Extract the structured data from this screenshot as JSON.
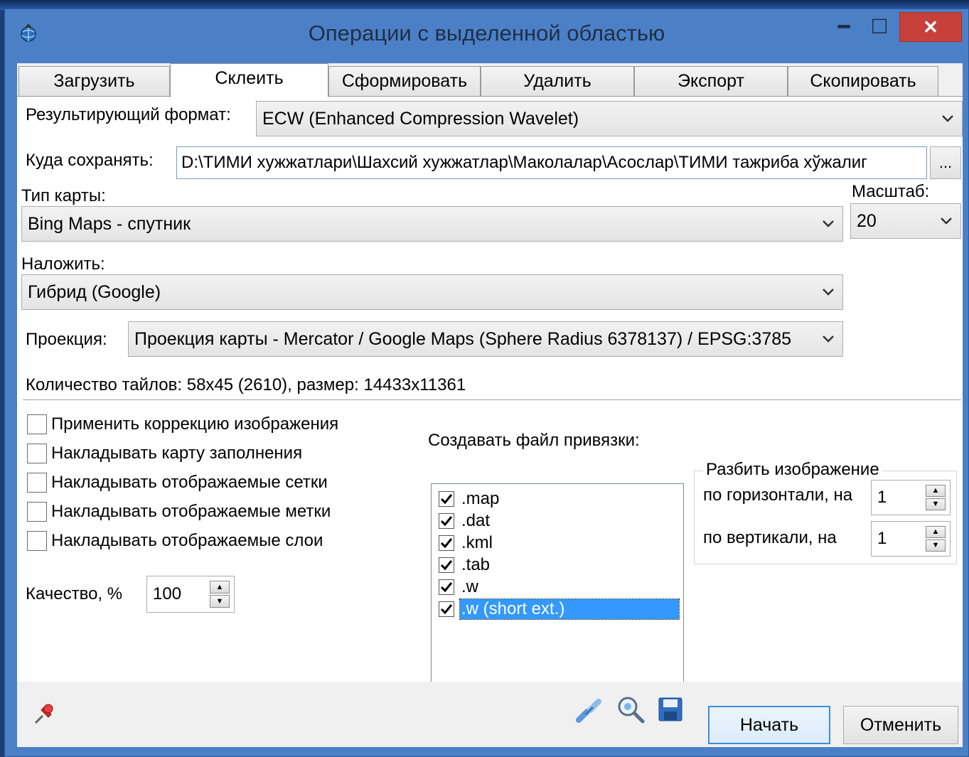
{
  "window": {
    "title": "Операции с выделенной областью",
    "controls": {
      "minimize": "━",
      "maximize": "☐",
      "close": "✕"
    }
  },
  "tabs": [
    {
      "label": "Загрузить",
      "active": false
    },
    {
      "label": "Склеить",
      "active": true
    },
    {
      "label": "Сформировать",
      "active": false
    },
    {
      "label": "Удалить",
      "active": false
    },
    {
      "label": "Экспорт",
      "active": false
    },
    {
      "label": "Скопировать",
      "active": false
    }
  ],
  "form": {
    "format_label": "Результирующий формат:",
    "format_value": "ECW (Enhanced Compression Wavelet)",
    "save_label": "Куда сохранять:",
    "save_path": "D:\\ТИМИ хужжатлари\\Шахсий хужжатлар\\Маколалар\\Асослар\\ТИМИ тажриба хўжалиг",
    "browse_label": "...",
    "map_type_label": "Тип карты:",
    "map_type_value": "Bing Maps - спутник",
    "scale_label": "Масштаб:",
    "scale_value": "20",
    "overlay_label": "Наложить:",
    "overlay_value": "Гибрид (Google)",
    "projection_label": "Проекция:",
    "projection_value": "Проекция карты - Mercator / Google Maps (Sphere Radius 6378137) / EPSG:3785",
    "tiles_info": "Количество тайлов: 58x45 (2610), размер: 14433x11361"
  },
  "options": [
    {
      "label": "Применить коррекцию изображения",
      "checked": false
    },
    {
      "label": "Накладывать карту заполнения",
      "checked": false
    },
    {
      "label": "Накладывать отображаемые сетки",
      "checked": false
    },
    {
      "label": "Накладывать отображаемые метки",
      "checked": false
    },
    {
      "label": "Накладывать отображаемые слои",
      "checked": false
    }
  ],
  "quality": {
    "label": "Качество, %",
    "value": "100"
  },
  "georef": {
    "label": "Создавать файл привязки:",
    "items": [
      {
        "label": ".map",
        "checked": true
      },
      {
        "label": ".dat",
        "checked": true
      },
      {
        "label": ".kml",
        "checked": true
      },
      {
        "label": ".tab",
        "checked": true
      },
      {
        "label": ".w",
        "checked": true
      },
      {
        "label": ".w (short ext.)",
        "checked": true,
        "selected": true
      }
    ]
  },
  "split": {
    "title": "Разбить изображение",
    "horizontal_label": "по горизонтали, на",
    "horizontal_value": "1",
    "vertical_label": "по вертикали, на",
    "vertical_value": "1"
  },
  "footer": {
    "start_label": "Начать",
    "cancel_label": "Отменить"
  },
  "colors": {
    "accent": "#3c8ee0",
    "selection": "#3399ff",
    "close_button": "#c7403a",
    "window_frame": "#4c80c6"
  }
}
